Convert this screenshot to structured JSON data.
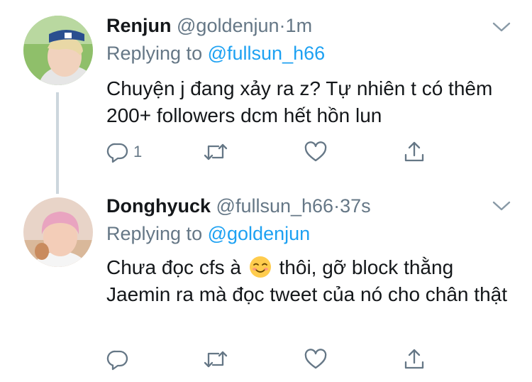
{
  "tweets": [
    {
      "name": "Renjun",
      "handle": "@goldenjun",
      "separator": "·",
      "time": "1m",
      "replying_prefix": "Replying to",
      "replying_to": "@fullsun_h66",
      "text": "Chuyện j đang xảy ra z? Tự nhiên t có thêm 200+ followers dcm hết hồn lun",
      "reply_count": "1",
      "avatar_colors": {
        "bg": "#8fbf6a",
        "hair": "#e9d8a6",
        "cap": "#2a4f8f",
        "face": "#f1d2bd"
      }
    },
    {
      "name": "Donghyuck",
      "handle": "@fullsun_h66",
      "separator": "·",
      "time": "37s",
      "replying_prefix": "Replying to",
      "replying_to": "@goldenjun",
      "text_before_emoji": "Chưa đọc cfs à",
      "emoji": "relieved-face-emoji",
      "text_after_emoji": "thôi, gỡ block thằng Jaemin ra mà đọc tweet của nó cho chân thật",
      "reply_count": "",
      "avatar_colors": {
        "bg": "#e8d4c8",
        "hair": "#e9a4c0",
        "face": "#f3cdb8"
      }
    }
  ],
  "colors": {
    "text": "#14171a",
    "secondary": "#657786",
    "link": "#1da1f2",
    "thread": "#ccd6dd"
  },
  "icons": [
    "reply-icon",
    "retweet-icon",
    "like-icon",
    "share-icon",
    "chevron-down-icon"
  ]
}
